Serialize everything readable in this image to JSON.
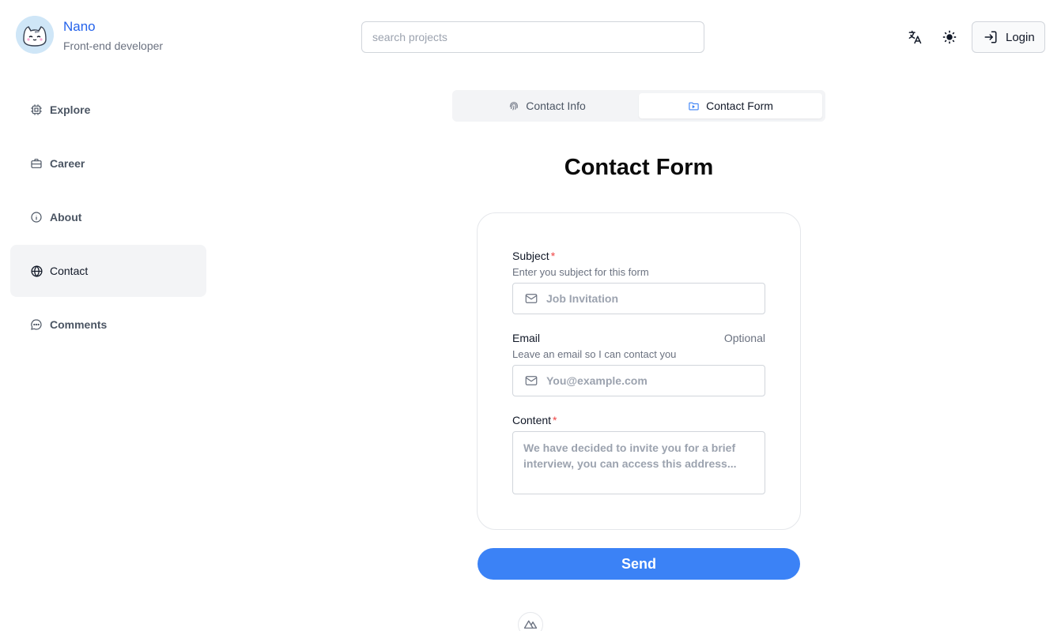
{
  "header": {
    "name": "Nano",
    "role": "Front-end developer",
    "search_placeholder": "search projects",
    "login_label": "Login",
    "translate_icon": "translate-icon",
    "theme_icon": "sun-icon"
  },
  "sidebar": {
    "items": [
      {
        "label": "Explore",
        "icon": "chip-icon",
        "active": false
      },
      {
        "label": "Career",
        "icon": "briefcase-icon",
        "active": false
      },
      {
        "label": "About",
        "icon": "info-icon",
        "active": false
      },
      {
        "label": "Contact",
        "icon": "globe-icon",
        "active": true
      },
      {
        "label": "Comments",
        "icon": "chat-bubble-icon",
        "active": false
      }
    ]
  },
  "tabs": [
    {
      "label": "Contact Info",
      "icon": "fingerprint-icon",
      "active": false
    },
    {
      "label": "Contact Form",
      "icon": "folder-icon",
      "active": true
    }
  ],
  "main": {
    "title": "Contact Form"
  },
  "form": {
    "subject": {
      "label": "Subject",
      "required_mark": "*",
      "help": "Enter you subject for this form",
      "placeholder": "Job Invitation"
    },
    "email": {
      "label": "Email",
      "optional": "Optional",
      "help": "Leave an email so I can contact you",
      "placeholder": "You@example.com"
    },
    "content": {
      "label": "Content",
      "required_mark": "*",
      "placeholder": "We have decided to invite you for a brief interview, you can access this address..."
    },
    "send_label": "Send"
  },
  "colors": {
    "accent": "#3b82f6",
    "brand_name": "#2563eb",
    "required": "#ef4444"
  }
}
